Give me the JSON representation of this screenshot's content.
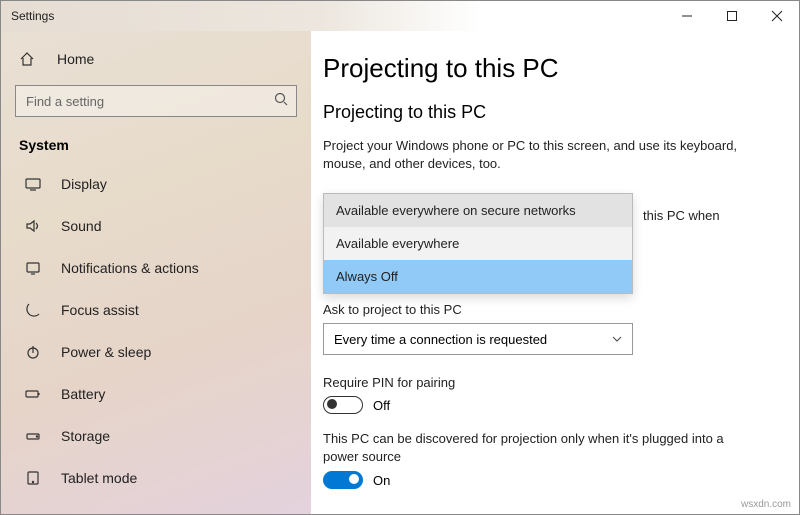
{
  "window": {
    "title": "Settings"
  },
  "sidebar": {
    "home": "Home",
    "search_placeholder": "Find a setting",
    "section": "System",
    "items": [
      {
        "label": "Display"
      },
      {
        "label": "Sound"
      },
      {
        "label": "Notifications & actions"
      },
      {
        "label": "Focus assist"
      },
      {
        "label": "Power & sleep"
      },
      {
        "label": "Battery"
      },
      {
        "label": "Storage"
      },
      {
        "label": "Tablet mode"
      }
    ]
  },
  "main": {
    "page_title": "Projecting to this PC",
    "section_title": "Projecting to this PC",
    "description": "Project your Windows phone or PC to this screen, and use its keyboard, mouse, and other devices, too.",
    "behind_text": "this PC when",
    "dropdown_open": {
      "options": [
        "Available everywhere on secure networks",
        "Available everywhere",
        "Always Off"
      ],
      "selected_index": 2
    },
    "ask_label": "Ask to project to this PC",
    "ask_value": "Every time a connection is requested",
    "pin_label": "Require PIN for pairing",
    "pin_value": "Off",
    "discover_label": "This PC can be discovered for projection only when it's plugged into a power source",
    "discover_value": "On"
  },
  "watermark": "wsxdn.com"
}
